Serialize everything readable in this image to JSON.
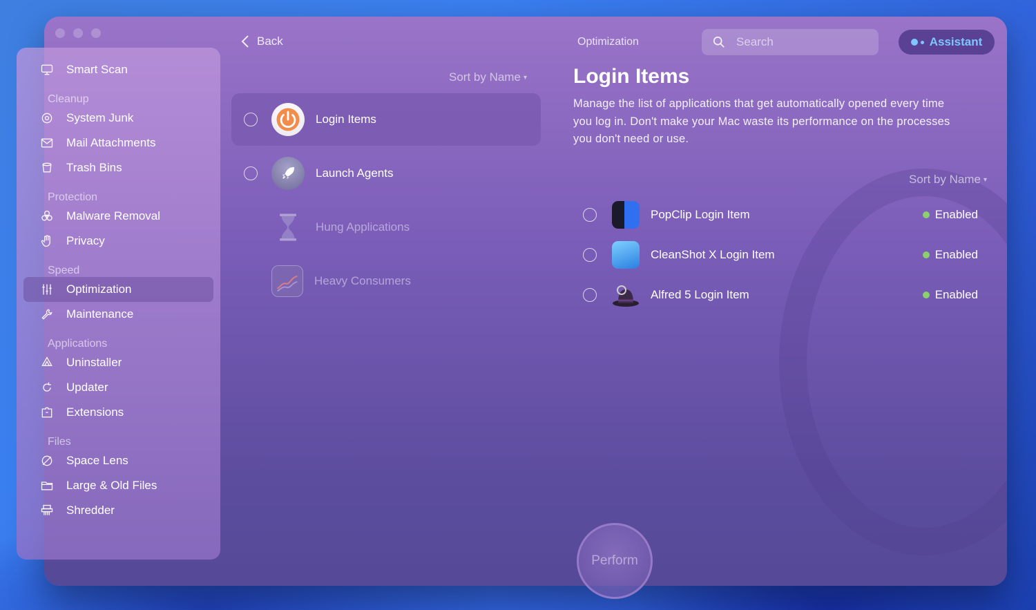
{
  "window": {
    "title": "Optimization"
  },
  "nav": {
    "back_label": "Back"
  },
  "search": {
    "placeholder": "Search"
  },
  "assistant": {
    "label": "Assistant",
    "color": "#7ec6ff"
  },
  "sidebar": {
    "items": [
      {
        "label": "Smart Scan",
        "icon": "smart-scan-icon"
      },
      {
        "section": "Cleanup"
      },
      {
        "label": "System Junk",
        "icon": "system-junk-icon"
      },
      {
        "label": "Mail Attachments",
        "icon": "mail-icon"
      },
      {
        "label": "Trash Bins",
        "icon": "trash-icon"
      },
      {
        "section": "Protection"
      },
      {
        "label": "Malware Removal",
        "icon": "biohazard-icon"
      },
      {
        "label": "Privacy",
        "icon": "hand-icon"
      },
      {
        "section": "Speed"
      },
      {
        "label": "Optimization",
        "icon": "sliders-icon",
        "active": true
      },
      {
        "label": "Maintenance",
        "icon": "wrench-icon"
      },
      {
        "section": "Applications"
      },
      {
        "label": "Uninstaller",
        "icon": "uninstaller-icon"
      },
      {
        "label": "Updater",
        "icon": "updater-icon"
      },
      {
        "label": "Extensions",
        "icon": "extensions-icon"
      },
      {
        "section": "Files"
      },
      {
        "label": "Space Lens",
        "icon": "space-lens-icon"
      },
      {
        "label": "Large & Old Files",
        "icon": "folder-icon"
      },
      {
        "label": "Shredder",
        "icon": "shredder-icon"
      }
    ]
  },
  "categories": {
    "sort_label": "Sort by Name",
    "items": [
      {
        "label": "Login Items",
        "icon": "power-icon",
        "selected": true,
        "enabled": true
      },
      {
        "label": "Launch Agents",
        "icon": "rocket-icon",
        "selected": false,
        "enabled": true
      },
      {
        "label": "Hung Applications",
        "icon": "hourglass-icon",
        "selected": false,
        "enabled": false
      },
      {
        "label": "Heavy Consumers",
        "icon": "chart-icon",
        "selected": false,
        "enabled": false
      }
    ]
  },
  "detail": {
    "title": "Login Items",
    "description": "Manage the list of applications that get automatically opened every time you log in. Don't make your Mac waste its performance on the processes you don't need or use.",
    "sort_label": "Sort by Name",
    "items": [
      {
        "name": "PopClip Login Item",
        "status": "Enabled",
        "icon": "popclip-icon"
      },
      {
        "name": "CleanShot X Login Item",
        "status": "Enabled",
        "icon": "cleanshot-icon"
      },
      {
        "name": "Alfred 5 Login Item",
        "status": "Enabled",
        "icon": "alfred-icon"
      }
    ],
    "status_color": "#8bd06a"
  },
  "perform": {
    "label": "Perform"
  }
}
